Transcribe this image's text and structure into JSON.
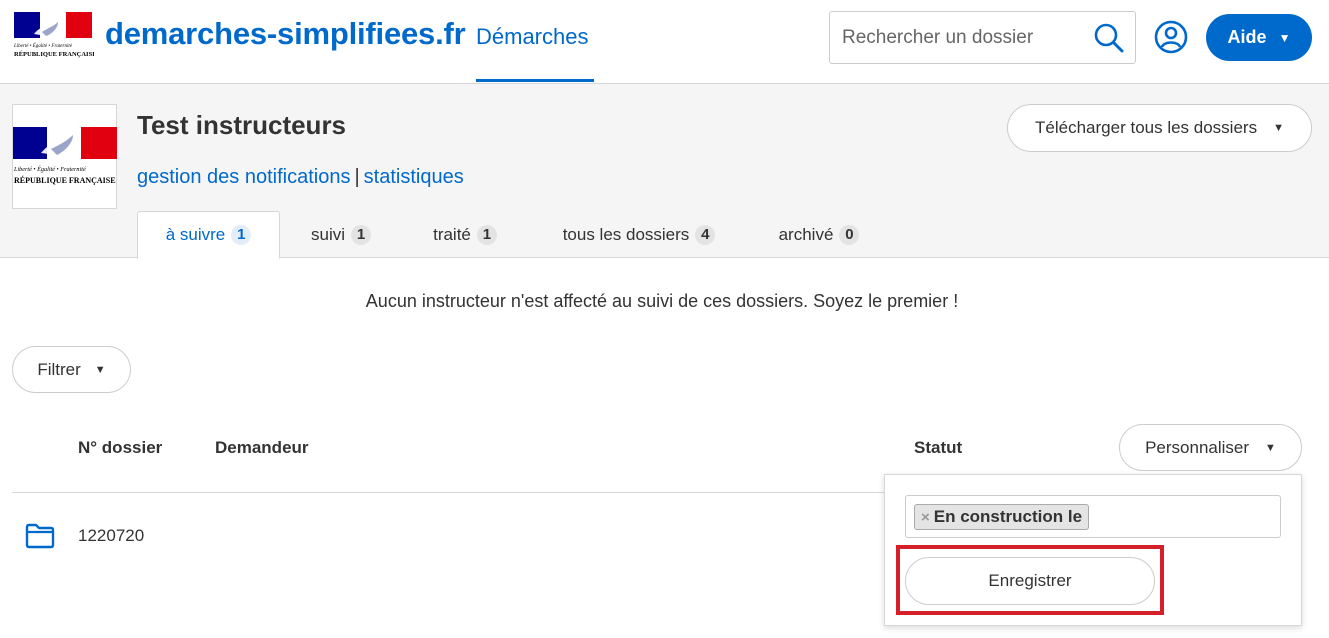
{
  "header": {
    "logo_line1": "Liberté • Égalité • Fraternité",
    "logo_line2": "RÉPUBLIQUE FRANÇAISE",
    "site_name": "demarches-simplifiees.fr",
    "nav_tab": "Démarches",
    "search_placeholder": "Rechercher un dossier",
    "help_button": "Aide",
    "brand_color": "#0069cc"
  },
  "procedure": {
    "logo_line1": "Liberté • Égalité • Fraternité",
    "logo_line2": "RÉPUBLIQUE FRANÇAISE",
    "title": "Test instructeurs",
    "link_notifications": "gestion des notifications",
    "separator": "|",
    "link_stats": "statistiques",
    "download_button": "Télécharger tous les dossiers",
    "tabs": [
      {
        "label": "à suivre",
        "count": "1",
        "active": true
      },
      {
        "label": "suivi",
        "count": "1",
        "active": false
      },
      {
        "label": "traité",
        "count": "1",
        "active": false
      },
      {
        "label": "tous les dossiers",
        "count": "4",
        "active": false
      },
      {
        "label": "archivé",
        "count": "0",
        "active": false
      }
    ]
  },
  "main": {
    "notice": "Aucun instructeur n'est affecté au suivi de ces dossiers. Soyez le premier !",
    "filter_button": "Filtrer",
    "columns": [
      "N° dossier",
      "Demandeur",
      "Statut"
    ],
    "customize_button": "Personnaliser",
    "rows": [
      {
        "number": "1220720"
      }
    ]
  },
  "dropdown": {
    "chip_remove": "×",
    "chip_label": "En construction le",
    "save_button": "Enregistrer",
    "highlight_color": "#d5202a"
  }
}
